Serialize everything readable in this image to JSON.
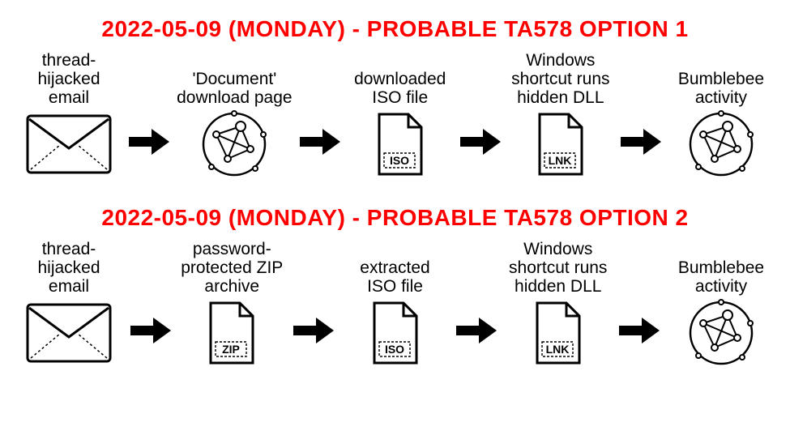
{
  "chart_data": [
    {
      "type": "flow",
      "title": "2022-05-09 (MONDAY) - PROBABLE TA578 OPTION 1",
      "steps": [
        {
          "label": "thread-\nhijacked\nemail",
          "icon": "envelope"
        },
        {
          "label": "'Document'\ndownload page",
          "icon": "network"
        },
        {
          "label": "downloaded\nISO file",
          "icon": "file",
          "tag": "ISO"
        },
        {
          "label": "Windows\nshortcut runs\nhidden DLL",
          "icon": "file",
          "tag": "LNK"
        },
        {
          "label": "Bumblebee\nactivity",
          "icon": "network"
        }
      ]
    },
    {
      "type": "flow",
      "title": "2022-05-09 (MONDAY) - PROBABLE TA578 OPTION 2",
      "steps": [
        {
          "label": "thread-\nhijacked\nemail",
          "icon": "envelope"
        },
        {
          "label": "password-\nprotected ZIP\narchive",
          "icon": "file",
          "tag": "ZIP"
        },
        {
          "label": "extracted\nISO file",
          "icon": "file",
          "tag": "ISO"
        },
        {
          "label": "Windows\nshortcut runs\nhidden DLL",
          "icon": "file",
          "tag": "LNK"
        },
        {
          "label": "Bumblebee\nactivity",
          "icon": "network"
        }
      ]
    }
  ]
}
